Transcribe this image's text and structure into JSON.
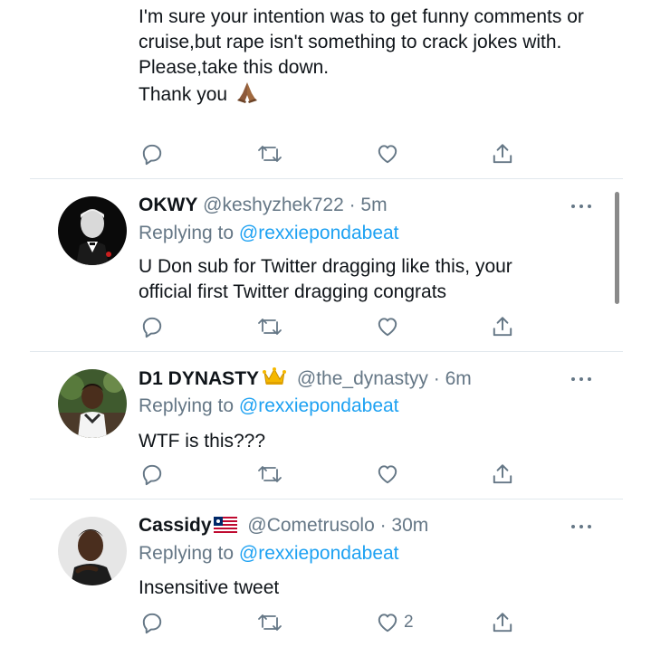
{
  "top_tweet": {
    "body": "I'm sure your intention was to get funny comments or cruise,but rape isn't something to crack jokes with.\nPlease,take this down.\nThank you",
    "emoji": "folded-hands-emoji"
  },
  "tweets": [
    {
      "name": "OKWY",
      "handle": "@keshyzhek722",
      "time": "· 5m",
      "reply_prefix": "Replying to",
      "reply_to": "@rexxiepondabeat",
      "body": "U Don sub for Twitter dragging like this, your official first Twitter dragging congrats",
      "like_count": ""
    },
    {
      "name": "D1 DYNASTY",
      "badge": "crown-emoji",
      "handle": "@the_dynastyy",
      "time": "· 6m",
      "reply_prefix": "Replying to",
      "reply_to": "@rexxiepondabeat",
      "body": "WTF is this???",
      "like_count": ""
    },
    {
      "name": "Cassidy",
      "badge": "liberia-flag-emoji",
      "handle": "@Cometrusolo",
      "time": "· 30m",
      "reply_prefix": "Replying to",
      "reply_to": "@rexxiepondabeat",
      "body": "Insensitive tweet",
      "like_count": "2"
    }
  ],
  "colors": {
    "text": "#0f1419",
    "secondary": "#657786",
    "link": "#1da1f2",
    "divider": "#e1e8ed"
  }
}
